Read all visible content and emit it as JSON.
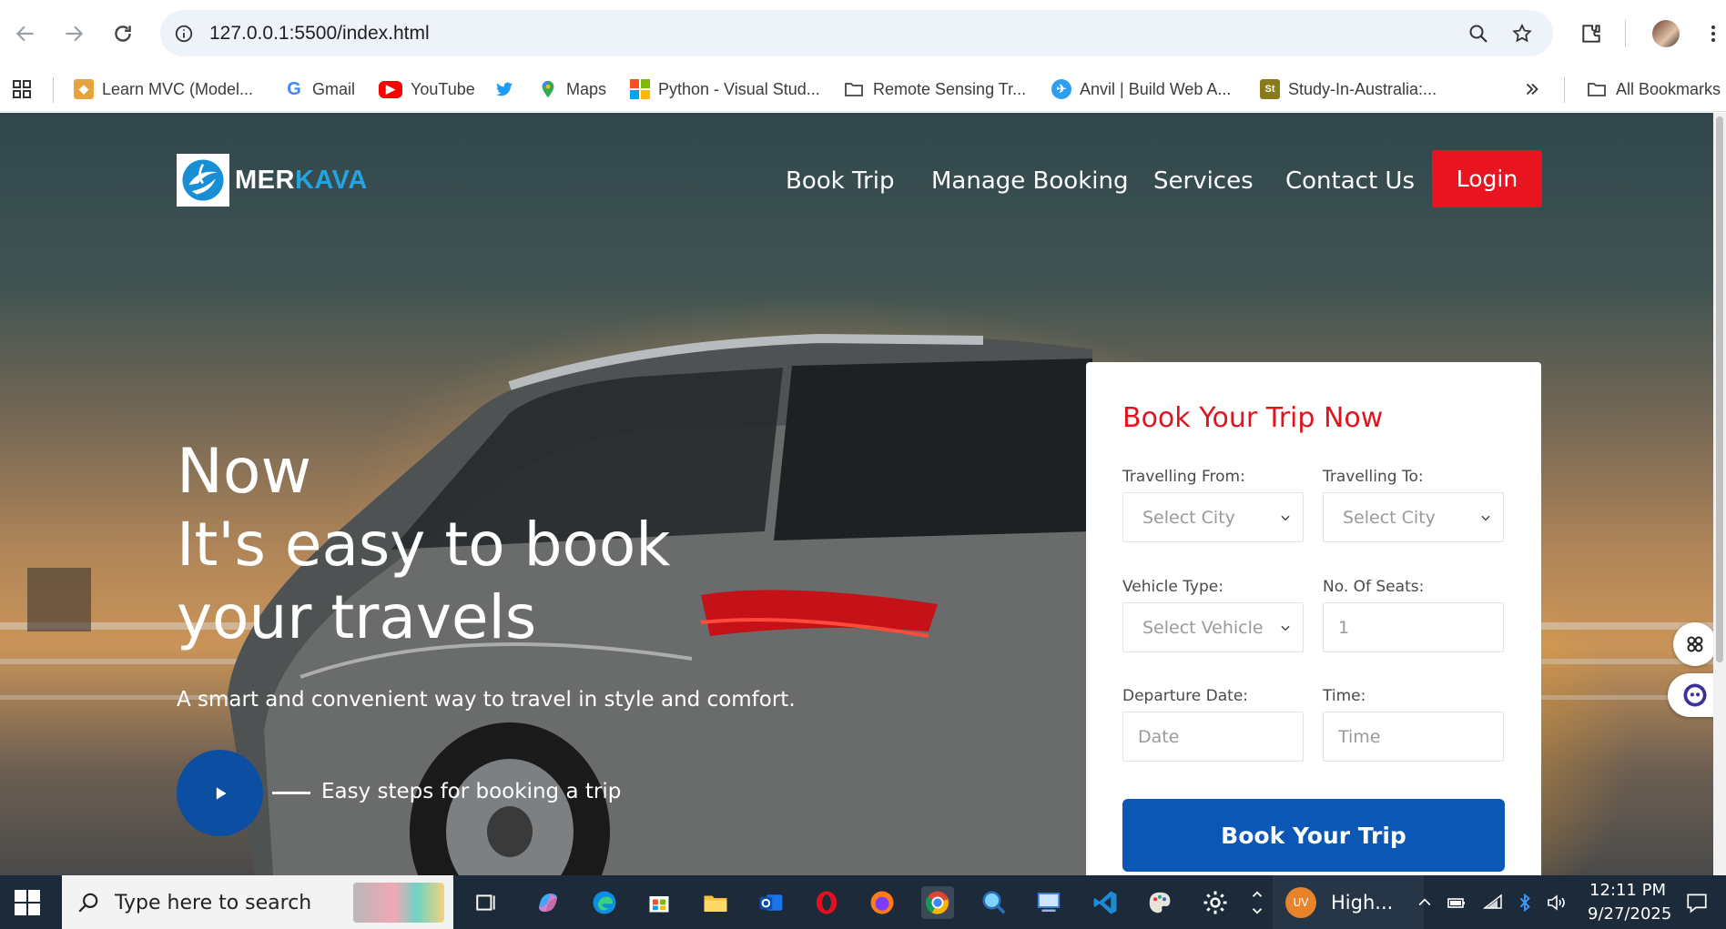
{
  "browser": {
    "url": "127.0.0.1:5500/index.html",
    "bookmarks": [
      {
        "label": "Learn MVC (Model...",
        "icon": "mvc-icon",
        "color": "#e6a23c"
      },
      {
        "label": "Gmail",
        "icon": "google-icon",
        "color": "#4285f4"
      },
      {
        "label": "YouTube",
        "icon": "youtube-icon",
        "color": "#ff0000"
      },
      {
        "label": "",
        "icon": "twitter-icon",
        "color": "#1d9bf0"
      },
      {
        "label": "Maps",
        "icon": "maps-icon",
        "color": "#34a853"
      },
      {
        "label": "Python - Visual Stud...",
        "icon": "microsoft-icon",
        "color": "#f25022"
      },
      {
        "label": "Remote Sensing Tr...",
        "icon": "folder-icon",
        "color": "#5f6368"
      },
      {
        "label": "Anvil | Build Web A...",
        "icon": "anvil-icon",
        "color": "#2d9ef0"
      },
      {
        "label": "Study-In-Australia:...",
        "icon": "study-icon",
        "color": "#8a7b1a"
      }
    ],
    "all_bookmarks": "All Bookmarks"
  },
  "site": {
    "logo_part1": "MER",
    "logo_part2": "KAVA",
    "nav": [
      "Book Trip",
      "Manage Booking",
      "Services",
      "Contact Us"
    ],
    "login": "Login",
    "hero": {
      "line1": "Now",
      "line2": "It's easy to book your travels",
      "subtitle": "A smart and convenient way to travel in style and comfort.",
      "steps": "Easy steps for booking a trip"
    },
    "booking": {
      "title": "Book Your Trip Now",
      "from_label": "Travelling From:",
      "from_value": "Select City",
      "to_label": "Travelling To:",
      "to_value": "Select City",
      "vehicle_label": "Vehicle Type:",
      "vehicle_value": "Select Vehicle",
      "seats_label": "No. Of Seats:",
      "seats_value": "1",
      "date_label": "Departure Date:",
      "date_placeholder": "Date",
      "time_label": "Time:",
      "time_placeholder": "Time",
      "submit": "Book Your Trip"
    }
  },
  "taskbar": {
    "search_placeholder": "Type here to search",
    "weather": "High...",
    "weather_badge": "UV",
    "time": "12:11 PM",
    "date": "9/27/2025"
  },
  "colors": {
    "accent_red": "#e8141f",
    "primary_blue": "#0b57b5",
    "logo_blue": "#23a3e0"
  }
}
